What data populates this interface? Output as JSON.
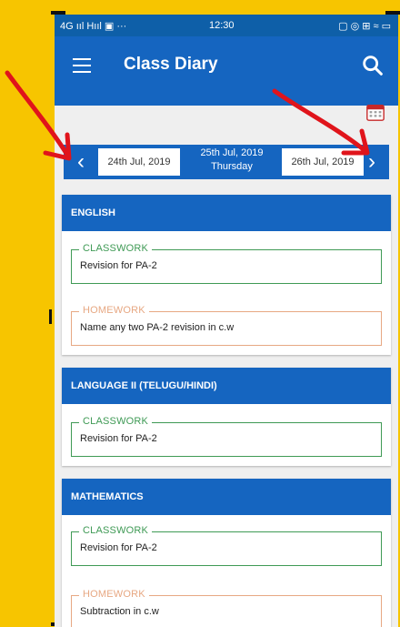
{
  "status_bar": {
    "network": "4G ııl Hııl ▣ ···",
    "time": "12:30",
    "icons": "▢ ◎ ⊞ ≈ ▭"
  },
  "app_bar": {
    "title": "Class Diary",
    "menu_icon": "hamburger-icon",
    "search_icon": "search-icon"
  },
  "date_nav": {
    "prev_date": "24th Jul, 2019",
    "current_date": "25th Jul, 2019",
    "current_day": "Thursday",
    "next_date": "26th Jul, 2019",
    "prev_icon": "chevron-left-icon",
    "next_icon": "chevron-right-icon",
    "calendar_icon": "calendar-icon"
  },
  "subjects": [
    {
      "name": "ENGLISH",
      "classwork_label": "CLASSWORK",
      "classwork": "Revision for PA-2",
      "homework_label": "HOMEWORK",
      "homework": "Name any two PA-2 revision in c.w"
    },
    {
      "name": "LANGUAGE II (TELUGU/HINDI)",
      "classwork_label": "CLASSWORK",
      "classwork": "Revision for PA-2"
    },
    {
      "name": "MATHEMATICS",
      "classwork_label": "CLASSWORK",
      "classwork": "Revision for PA-2",
      "homework_label": "HOMEWORK",
      "homework": "Subtraction in c.w"
    }
  ],
  "colors": {
    "primary": "#1565c0",
    "classwork": "#3f9a55",
    "homework": "#e7a883",
    "frame": "#f7c500",
    "annotation": "#e0141b"
  }
}
